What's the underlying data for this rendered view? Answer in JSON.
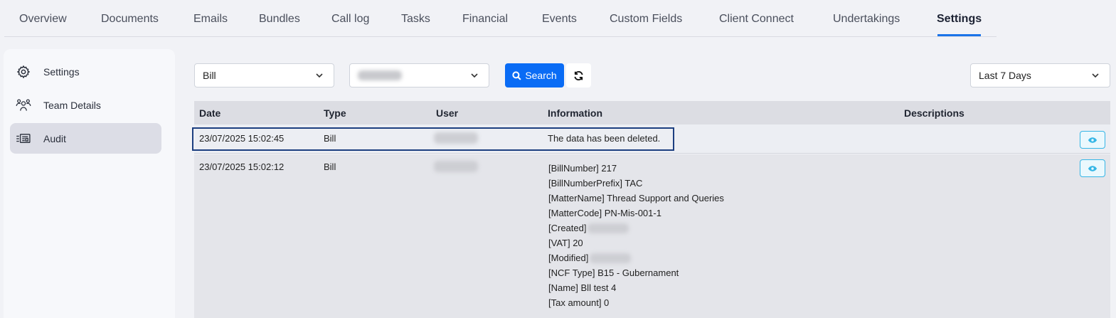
{
  "tabs": [
    {
      "label": "Overview"
    },
    {
      "label": "Documents"
    },
    {
      "label": "Emails"
    },
    {
      "label": "Bundles"
    },
    {
      "label": "Call log"
    },
    {
      "label": "Tasks"
    },
    {
      "label": "Financial"
    },
    {
      "label": "Events"
    },
    {
      "label": "Custom Fields"
    },
    {
      "label": "Client Connect"
    },
    {
      "label": "Undertakings"
    },
    {
      "label": "Settings",
      "active": true
    }
  ],
  "sidebar": {
    "items": [
      {
        "label": "Settings",
        "icon": "gear-icon"
      },
      {
        "label": "Team Details",
        "icon": "team-icon"
      },
      {
        "label": "Audit",
        "icon": "audit-icon",
        "active": true
      }
    ]
  },
  "filters": {
    "type_select": "Bill",
    "user_select": "",
    "search_label": "Search",
    "date_range": "Last 7 Days"
  },
  "table": {
    "headers": [
      "Date",
      "Type",
      "User",
      "Information",
      "Descriptions"
    ],
    "rows": [
      {
        "date": "23/07/2025 15:02:45",
        "type": "Bill",
        "information": [
          "The data has been deleted."
        ]
      },
      {
        "date": "23/07/2025 15:02:12",
        "type": "Bill",
        "information": [
          "[BillNumber] 217",
          "[BillNumberPrefix] TAC",
          "[MatterName] Thread Support and Queries",
          "[MatterCode] PN-Mis-001-1",
          "[Created]",
          "[VAT] 20",
          "[Modified]",
          "[NCF Type] B15 - Gubernament",
          "[Name] Bll test 4",
          "[Tax amount] 0"
        ]
      }
    ]
  },
  "colors": {
    "accent": "#0a6cf5",
    "active_tab_underline": "#1a73e8",
    "highlight_border": "#1c3f80",
    "eye_button": "#35b6e6"
  }
}
